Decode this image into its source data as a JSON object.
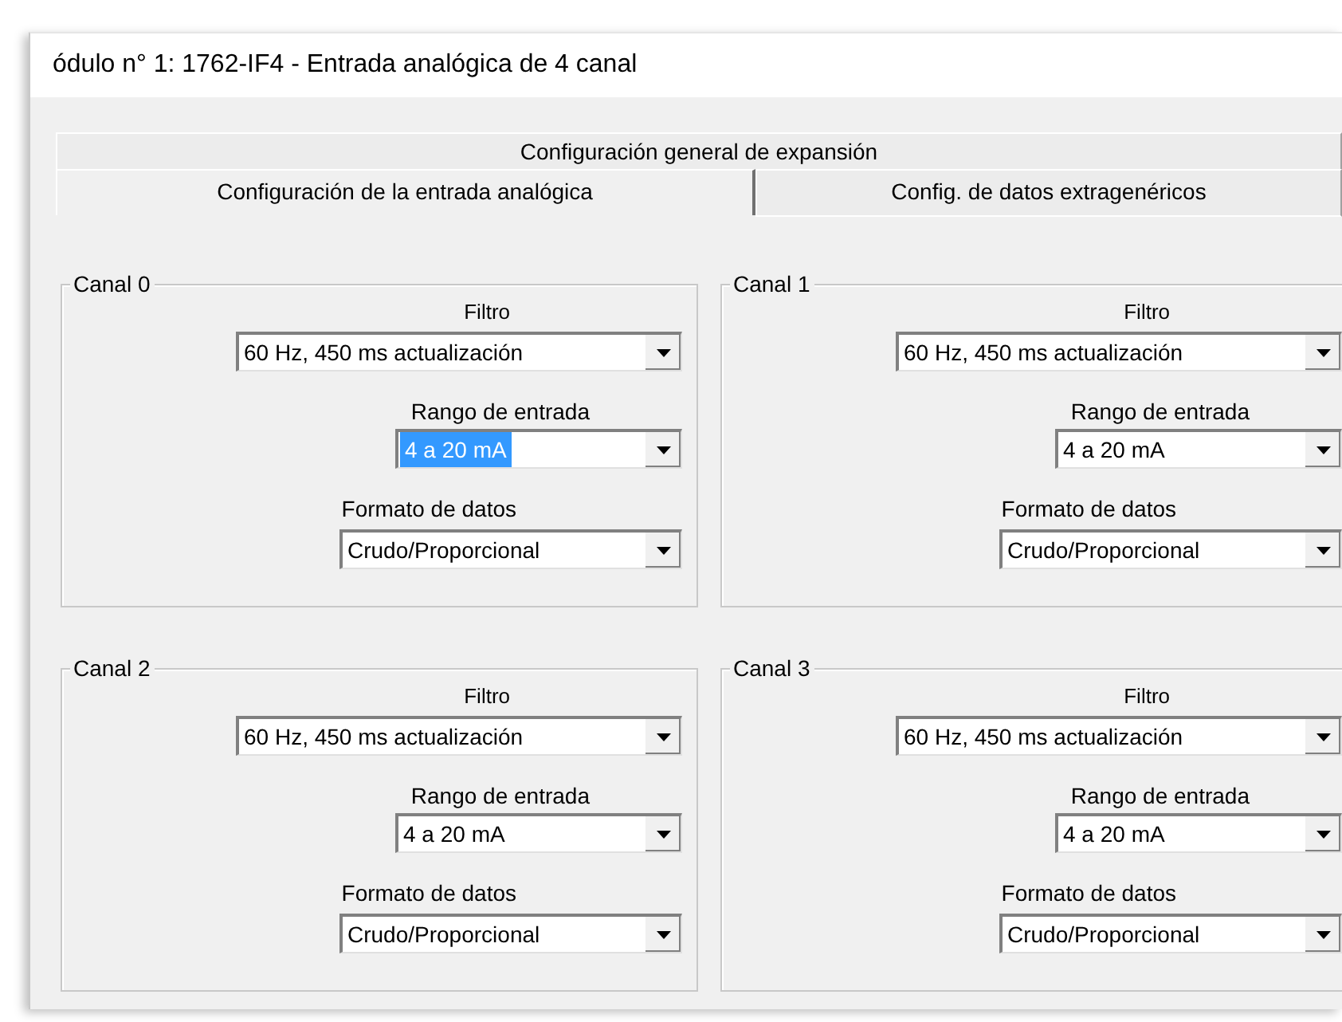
{
  "window": {
    "title": "ódulo n° 1: 1762-IF4 - Entrada analógica de 4 canal"
  },
  "tab_rows": [
    [
      {
        "label": "Configuración general de expansión",
        "selected": false
      }
    ],
    [
      {
        "label": "Configuración de la entrada analógica",
        "selected": true
      },
      {
        "label": "Config. de datos extragenéricos",
        "selected": false
      }
    ]
  ],
  "channels": [
    {
      "title": "Canal 0",
      "fields": [
        {
          "kind": "filter",
          "label": "Filtro",
          "value": "60 Hz, 450 ms actualización",
          "focused": false
        },
        {
          "kind": "range",
          "label": "Rango de entrada",
          "value": "4 a 20 mA",
          "focused": true
        },
        {
          "kind": "format",
          "label": "Formato de datos",
          "value": "Crudo/Proporcional",
          "focused": false
        }
      ]
    },
    {
      "title": "Canal 1",
      "fields": [
        {
          "kind": "filter",
          "label": "Filtro",
          "value": "60 Hz, 450 ms actualización",
          "focused": false
        },
        {
          "kind": "range",
          "label": "Rango de entrada",
          "value": "4 a 20 mA",
          "focused": false
        },
        {
          "kind": "format",
          "label": "Formato de datos",
          "value": "Crudo/Proporcional",
          "focused": false
        }
      ]
    },
    {
      "title": "Canal 2",
      "fields": [
        {
          "kind": "filter",
          "label": "Filtro",
          "value": "60 Hz, 450 ms actualización",
          "focused": false
        },
        {
          "kind": "range",
          "label": "Rango de entrada",
          "value": "4 a 20 mA",
          "focused": false
        },
        {
          "kind": "format",
          "label": "Formato de datos",
          "value": "Crudo/Proporcional",
          "focused": false
        }
      ]
    },
    {
      "title": "Canal 3",
      "fields": [
        {
          "kind": "filter",
          "label": "Filtro",
          "value": "60 Hz, 450 ms actualización",
          "focused": false
        },
        {
          "kind": "range",
          "label": "Rango de entrada",
          "value": "4 a 20 mA",
          "focused": false
        },
        {
          "kind": "format",
          "label": "Formato de datos",
          "value": "Crudo/Proporcional",
          "focused": false
        }
      ]
    }
  ]
}
